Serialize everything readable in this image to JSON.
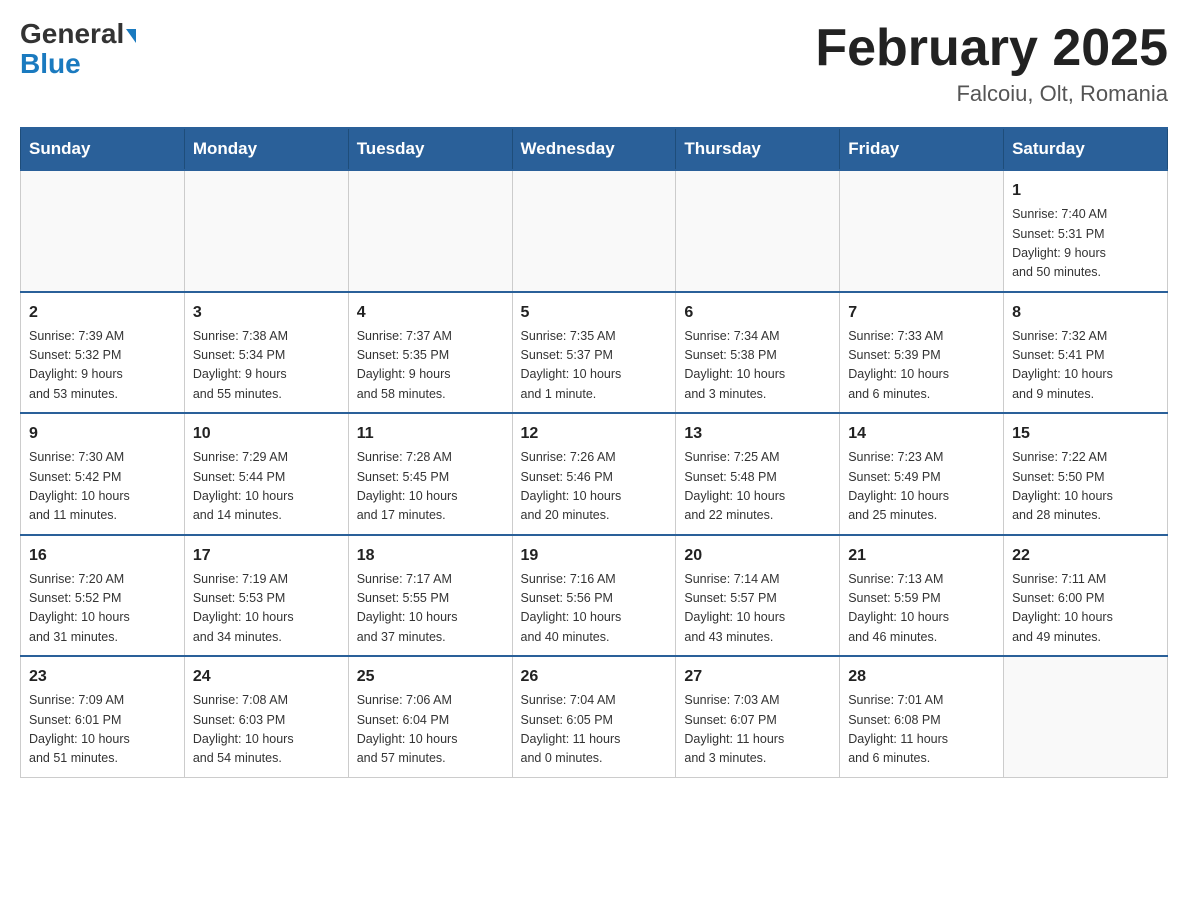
{
  "header": {
    "logo_part1": "General",
    "logo_part2": "Blue",
    "month_title": "February 2025",
    "location": "Falcoiu, Olt, Romania"
  },
  "days_of_week": [
    "Sunday",
    "Monday",
    "Tuesday",
    "Wednesday",
    "Thursday",
    "Friday",
    "Saturday"
  ],
  "weeks": [
    [
      {
        "day": "",
        "info": ""
      },
      {
        "day": "",
        "info": ""
      },
      {
        "day": "",
        "info": ""
      },
      {
        "day": "",
        "info": ""
      },
      {
        "day": "",
        "info": ""
      },
      {
        "day": "",
        "info": ""
      },
      {
        "day": "1",
        "info": "Sunrise: 7:40 AM\nSunset: 5:31 PM\nDaylight: 9 hours\nand 50 minutes."
      }
    ],
    [
      {
        "day": "2",
        "info": "Sunrise: 7:39 AM\nSunset: 5:32 PM\nDaylight: 9 hours\nand 53 minutes."
      },
      {
        "day": "3",
        "info": "Sunrise: 7:38 AM\nSunset: 5:34 PM\nDaylight: 9 hours\nand 55 minutes."
      },
      {
        "day": "4",
        "info": "Sunrise: 7:37 AM\nSunset: 5:35 PM\nDaylight: 9 hours\nand 58 minutes."
      },
      {
        "day": "5",
        "info": "Sunrise: 7:35 AM\nSunset: 5:37 PM\nDaylight: 10 hours\nand 1 minute."
      },
      {
        "day": "6",
        "info": "Sunrise: 7:34 AM\nSunset: 5:38 PM\nDaylight: 10 hours\nand 3 minutes."
      },
      {
        "day": "7",
        "info": "Sunrise: 7:33 AM\nSunset: 5:39 PM\nDaylight: 10 hours\nand 6 minutes."
      },
      {
        "day": "8",
        "info": "Sunrise: 7:32 AM\nSunset: 5:41 PM\nDaylight: 10 hours\nand 9 minutes."
      }
    ],
    [
      {
        "day": "9",
        "info": "Sunrise: 7:30 AM\nSunset: 5:42 PM\nDaylight: 10 hours\nand 11 minutes."
      },
      {
        "day": "10",
        "info": "Sunrise: 7:29 AM\nSunset: 5:44 PM\nDaylight: 10 hours\nand 14 minutes."
      },
      {
        "day": "11",
        "info": "Sunrise: 7:28 AM\nSunset: 5:45 PM\nDaylight: 10 hours\nand 17 minutes."
      },
      {
        "day": "12",
        "info": "Sunrise: 7:26 AM\nSunset: 5:46 PM\nDaylight: 10 hours\nand 20 minutes."
      },
      {
        "day": "13",
        "info": "Sunrise: 7:25 AM\nSunset: 5:48 PM\nDaylight: 10 hours\nand 22 minutes."
      },
      {
        "day": "14",
        "info": "Sunrise: 7:23 AM\nSunset: 5:49 PM\nDaylight: 10 hours\nand 25 minutes."
      },
      {
        "day": "15",
        "info": "Sunrise: 7:22 AM\nSunset: 5:50 PM\nDaylight: 10 hours\nand 28 minutes."
      }
    ],
    [
      {
        "day": "16",
        "info": "Sunrise: 7:20 AM\nSunset: 5:52 PM\nDaylight: 10 hours\nand 31 minutes."
      },
      {
        "day": "17",
        "info": "Sunrise: 7:19 AM\nSunset: 5:53 PM\nDaylight: 10 hours\nand 34 minutes."
      },
      {
        "day": "18",
        "info": "Sunrise: 7:17 AM\nSunset: 5:55 PM\nDaylight: 10 hours\nand 37 minutes."
      },
      {
        "day": "19",
        "info": "Sunrise: 7:16 AM\nSunset: 5:56 PM\nDaylight: 10 hours\nand 40 minutes."
      },
      {
        "day": "20",
        "info": "Sunrise: 7:14 AM\nSunset: 5:57 PM\nDaylight: 10 hours\nand 43 minutes."
      },
      {
        "day": "21",
        "info": "Sunrise: 7:13 AM\nSunset: 5:59 PM\nDaylight: 10 hours\nand 46 minutes."
      },
      {
        "day": "22",
        "info": "Sunrise: 7:11 AM\nSunset: 6:00 PM\nDaylight: 10 hours\nand 49 minutes."
      }
    ],
    [
      {
        "day": "23",
        "info": "Sunrise: 7:09 AM\nSunset: 6:01 PM\nDaylight: 10 hours\nand 51 minutes."
      },
      {
        "day": "24",
        "info": "Sunrise: 7:08 AM\nSunset: 6:03 PM\nDaylight: 10 hours\nand 54 minutes."
      },
      {
        "day": "25",
        "info": "Sunrise: 7:06 AM\nSunset: 6:04 PM\nDaylight: 10 hours\nand 57 minutes."
      },
      {
        "day": "26",
        "info": "Sunrise: 7:04 AM\nSunset: 6:05 PM\nDaylight: 11 hours\nand 0 minutes."
      },
      {
        "day": "27",
        "info": "Sunrise: 7:03 AM\nSunset: 6:07 PM\nDaylight: 11 hours\nand 3 minutes."
      },
      {
        "day": "28",
        "info": "Sunrise: 7:01 AM\nSunset: 6:08 PM\nDaylight: 11 hours\nand 6 minutes."
      },
      {
        "day": "",
        "info": ""
      }
    ]
  ]
}
